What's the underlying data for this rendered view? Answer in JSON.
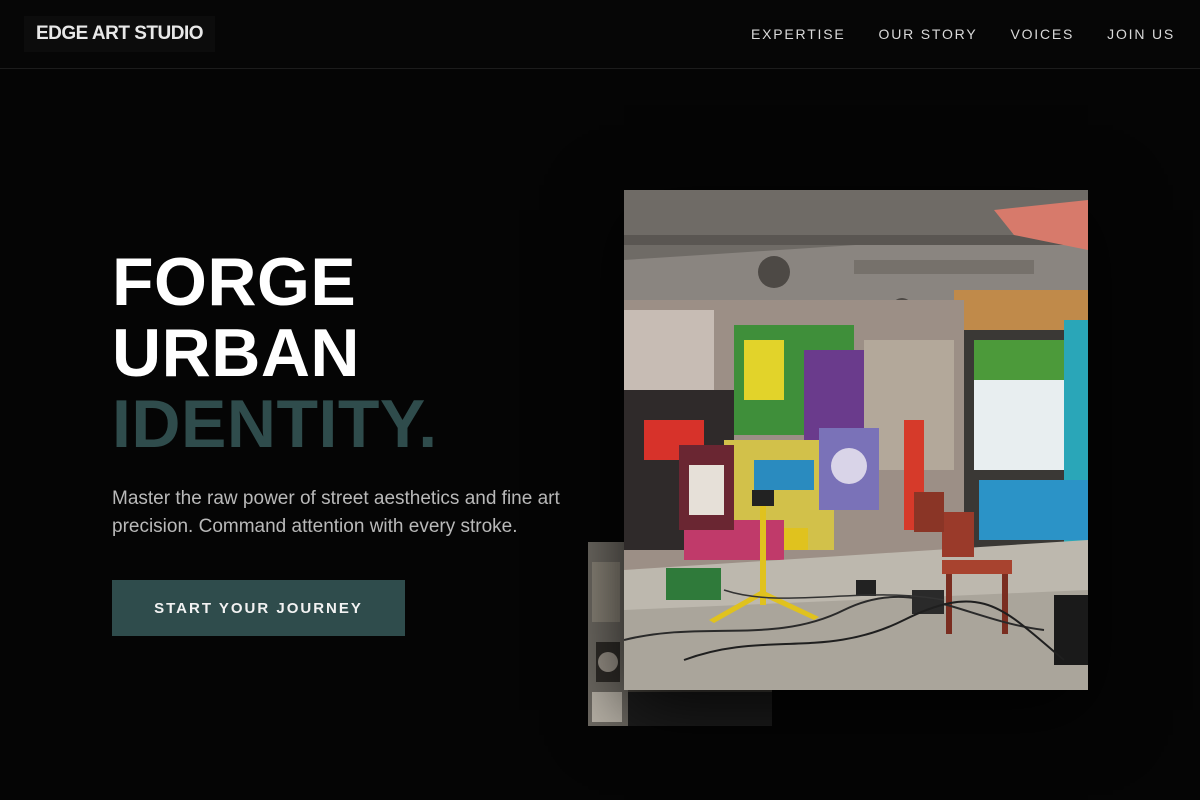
{
  "header": {
    "logo": "EDGE ART STUDIO",
    "nav": [
      "EXPERTISE",
      "OUR STORY",
      "VOICES",
      "JOIN US"
    ]
  },
  "hero": {
    "title_lines": [
      "FORGE",
      "URBAN"
    ],
    "title_accent": "IDENTITY.",
    "subtitle": "Master the raw power of street aesthetics and fine art precision. Command attention with every stroke.",
    "cta": "START YOUR JOURNEY"
  },
  "colors": {
    "background": "#050505",
    "accent": "#2f4c4c",
    "text_muted": "#b9b9b9"
  }
}
